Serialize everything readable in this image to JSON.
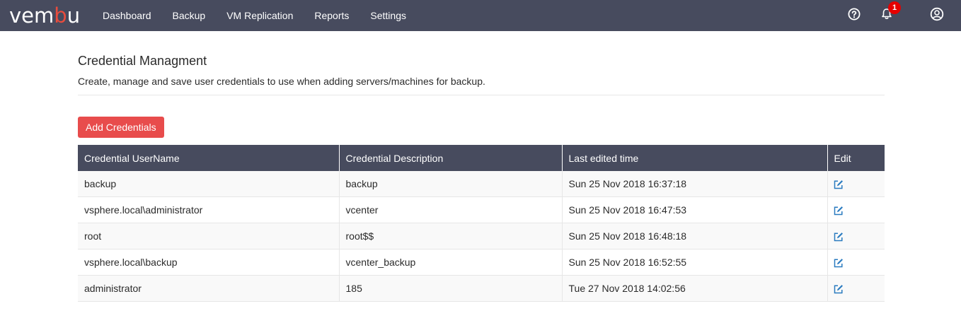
{
  "brand": {
    "logo_prefix": "vem",
    "logo_accent": "b",
    "logo_suffix": "u",
    "accent_color": "#e84c3d"
  },
  "nav": {
    "items": [
      "Dashboard",
      "Backup",
      "VM Replication",
      "Reports",
      "Settings"
    ]
  },
  "header_icons": {
    "help": "help-circle-icon",
    "bell": "bell-icon",
    "user": "user-circle-icon",
    "notification_count": "1"
  },
  "page": {
    "title": "Credential Managment",
    "description": "Create, manage and save user credentials to use when adding servers/machines for backup."
  },
  "actions": {
    "add_label": "Add Credentials"
  },
  "table": {
    "headers": [
      "Credential UserName",
      "Credential Description",
      "Last edited time",
      "Edit"
    ],
    "rows": [
      [
        "backup",
        "backup",
        "Sun 25 Nov 2018 16:37:18"
      ],
      [
        "vsphere.local\\administrator",
        "vcenter",
        "Sun 25 Nov 2018 16:47:53"
      ],
      [
        "root",
        "root$$",
        "Sun 25 Nov 2018 16:48:18"
      ],
      [
        "vsphere.local\\backup",
        "vcenter_backup",
        "Sun 25 Nov 2018 16:52:55"
      ],
      [
        "administrator",
        "185",
        "Tue 27 Nov 2018 14:02:56"
      ]
    ],
    "edit_icon": "edit-icon"
  },
  "colors": {
    "topbar": "#474b5e",
    "add_button": "#e84c4c",
    "badge": "#e60000",
    "edit_icon": "#2a7bc0"
  }
}
